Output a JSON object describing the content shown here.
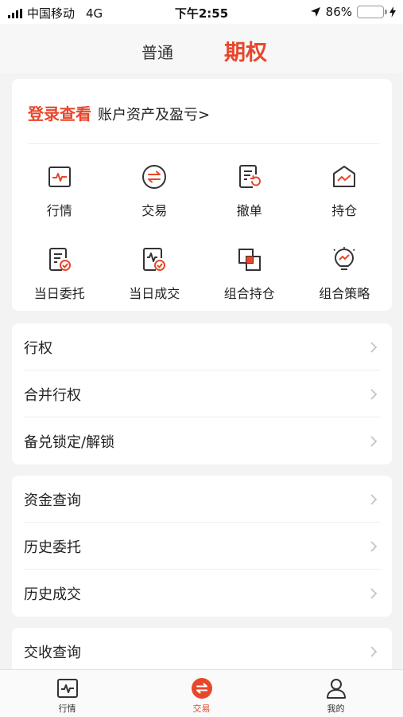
{
  "status_bar": {
    "carrier": "中国移动",
    "network": "4G",
    "time": "下午2:55",
    "battery": "86%",
    "battery_level": 0.86,
    "icons": [
      "signal-icon",
      "location-arrow-icon",
      "battery-icon",
      "charging-bolt-icon"
    ]
  },
  "top_tabs": [
    {
      "label": "普通",
      "active": false
    },
    {
      "label": "期权",
      "active": true
    }
  ],
  "assets_card": {
    "login_link": "登录查看",
    "login_desc": "账户资产及盈亏>"
  },
  "quick_actions": [
    {
      "label": "行情",
      "icon": "market-chart-icon"
    },
    {
      "label": "交易",
      "icon": "exchange-icon"
    },
    {
      "label": "撤单",
      "icon": "cancel-order-icon"
    },
    {
      "label": "持仓",
      "icon": "holdings-icon"
    },
    {
      "label": "当日委托",
      "icon": "today-orders-icon"
    },
    {
      "label": "当日成交",
      "icon": "today-trades-icon"
    },
    {
      "label": "组合持仓",
      "icon": "portfolio-holdings-icon"
    },
    {
      "label": "组合策略",
      "icon": "strategy-bulb-icon"
    }
  ],
  "menu_group1": [
    {
      "label": "行权"
    },
    {
      "label": "合并行权"
    },
    {
      "label": "备兑锁定/解锁"
    }
  ],
  "menu_group2": [
    {
      "label": "资金查询"
    },
    {
      "label": "历史委托"
    },
    {
      "label": "历史成交"
    }
  ],
  "menu_group3": [
    {
      "label": "交收查询"
    }
  ],
  "bottom_nav": [
    {
      "label": "行情",
      "icon": "market-chart-icon",
      "active": false
    },
    {
      "label": "交易",
      "icon": "exchange-icon",
      "active": true
    },
    {
      "label": "我的",
      "icon": "user-icon",
      "active": false
    }
  ],
  "colors": {
    "accent": "#e8472b",
    "background": "#f3f3f3",
    "card": "#ffffff",
    "text": "#222222",
    "icon_dark": "#333333"
  }
}
